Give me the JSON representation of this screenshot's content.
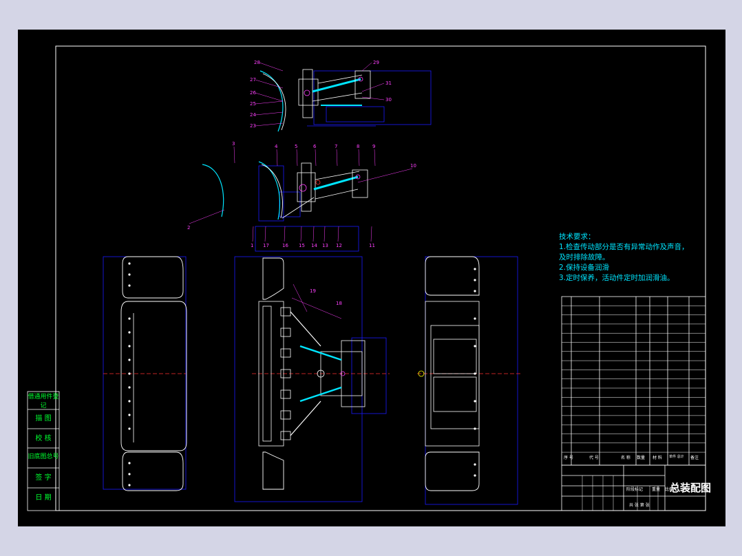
{
  "drawing": {
    "title": "总装配图",
    "tech_requirements": {
      "heading": "技术要求：",
      "items": [
        "1.检查传动部分是否有异常动作及声音，",
        "及时排除故障。",
        "2.保持设备润滑",
        "3.定时保养，活动件定时加润滑油。"
      ]
    },
    "side_stamp": {
      "header": "借通用件登记",
      "rows": [
        "描  图",
        "校  核",
        "旧底图总号",
        "签  字",
        "日  期"
      ]
    },
    "parts_header": {
      "seq": "序 号",
      "code": "代  号",
      "name": "名  称",
      "qty": "数量",
      "material": "材  料",
      "weight": "单件 总计",
      "note": "备注"
    },
    "title_block": {
      "stage": "阶段标记",
      "weight": "重量",
      "scale": "比例",
      "sheet": "共  张   第  张"
    },
    "colors": {
      "background": "#000000",
      "frame": "#ffffff",
      "dimension": "#1a1aff",
      "text_cyan": "#00e5ff",
      "label_magenta": "#ff40ff",
      "side_green": "#00ff30"
    },
    "balloons_top": [
      "28",
      "27",
      "26",
      "25",
      "24",
      "23",
      "29",
      "31",
      "30"
    ],
    "balloons_mid": [
      "3",
      "4",
      "5",
      "6",
      "7",
      "8",
      "9",
      "10",
      "2",
      "1",
      "17",
      "16",
      "15",
      "14",
      "13",
      "12",
      "11"
    ],
    "balloons_plan": [
      "19",
      "18"
    ]
  }
}
